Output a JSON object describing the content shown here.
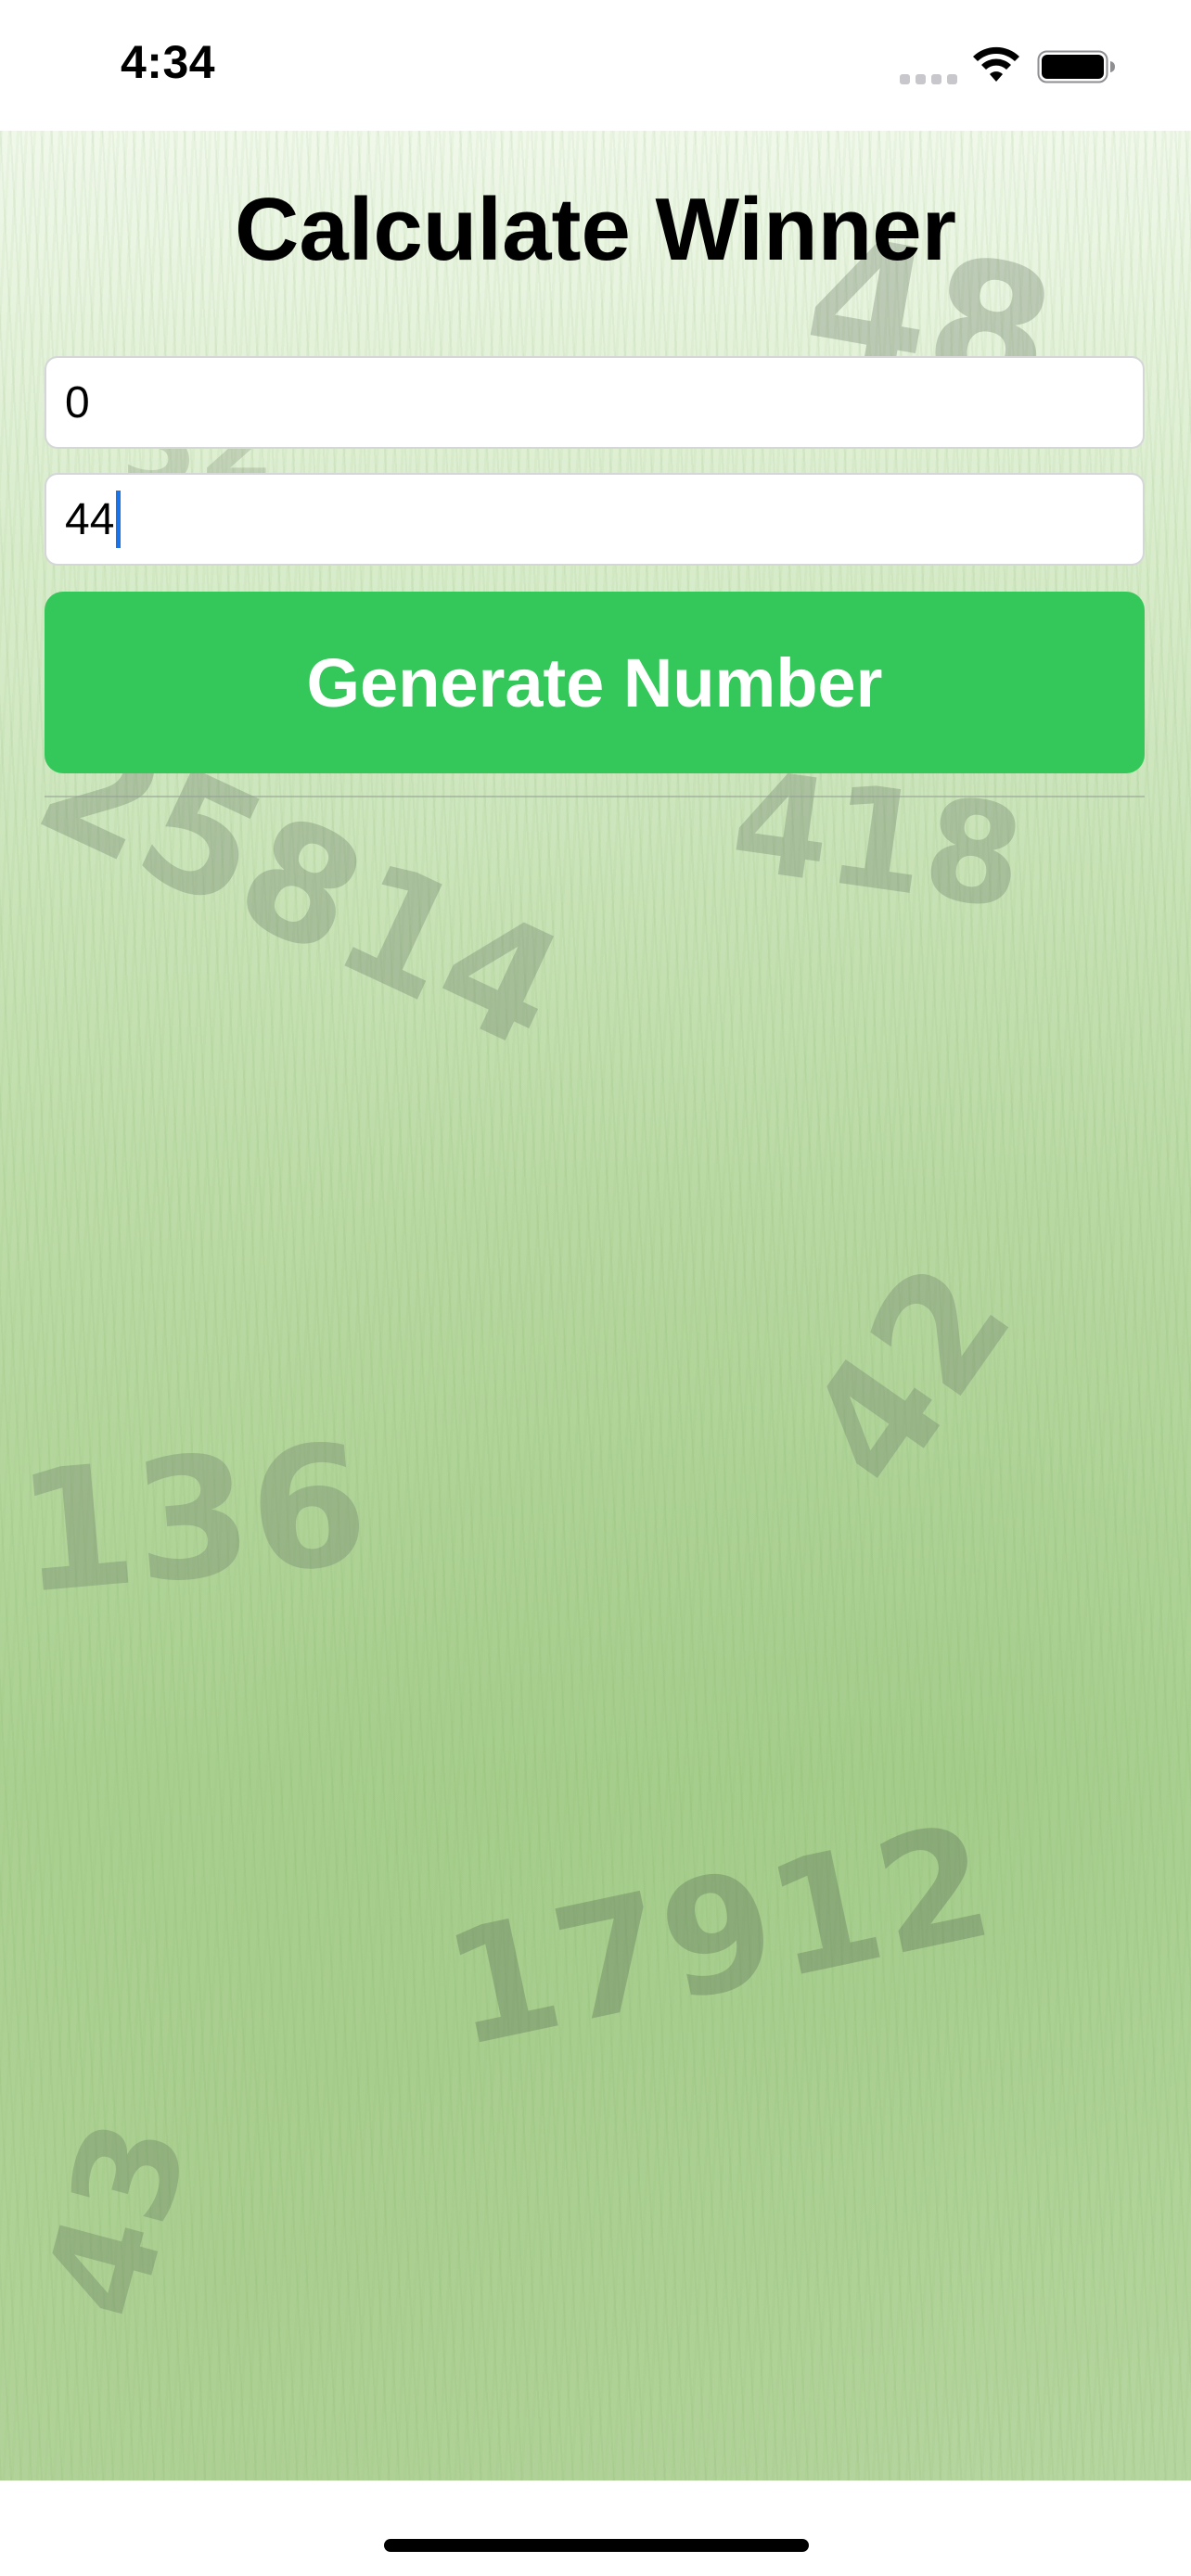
{
  "status_bar": {
    "time": "4:34",
    "signal_icon": "cellular-signal-dots",
    "wifi_icon": "wifi-icon",
    "battery_icon": "battery-full-icon"
  },
  "screen": {
    "title": "Calculate Winner",
    "min_field": {
      "value": "0"
    },
    "max_field": {
      "value": "44"
    },
    "generate_button": {
      "label": "Generate Number"
    },
    "colors": {
      "button_bg": "#34c759",
      "button_text": "#ffffff",
      "caret": "#1a73e8"
    }
  }
}
